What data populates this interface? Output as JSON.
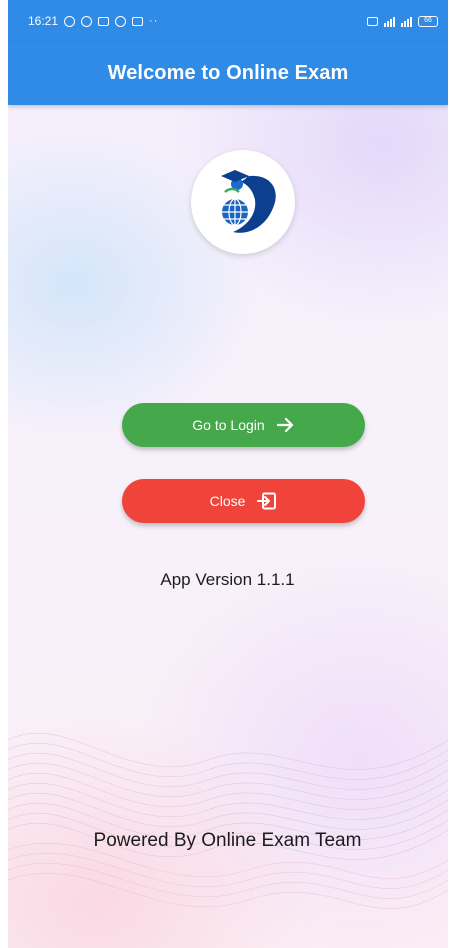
{
  "status_bar": {
    "time": "16:21",
    "battery": "66"
  },
  "app_bar": {
    "title": "Welcome to Online Exam"
  },
  "logo": {
    "icon": "graduate-globe-logo-icon"
  },
  "buttons": {
    "login": {
      "label": "Go to Login",
      "icon": "arrow-right-icon",
      "color": "#45a84a"
    },
    "close": {
      "label": "Close",
      "icon": "exit-icon",
      "color": "#f0433a"
    }
  },
  "version_text": "App Version 1.1.1",
  "footer_text": "Powered By Online Exam Team",
  "colors": {
    "primary": "#2f8be6",
    "login": "#45a84a",
    "close": "#f0433a"
  }
}
